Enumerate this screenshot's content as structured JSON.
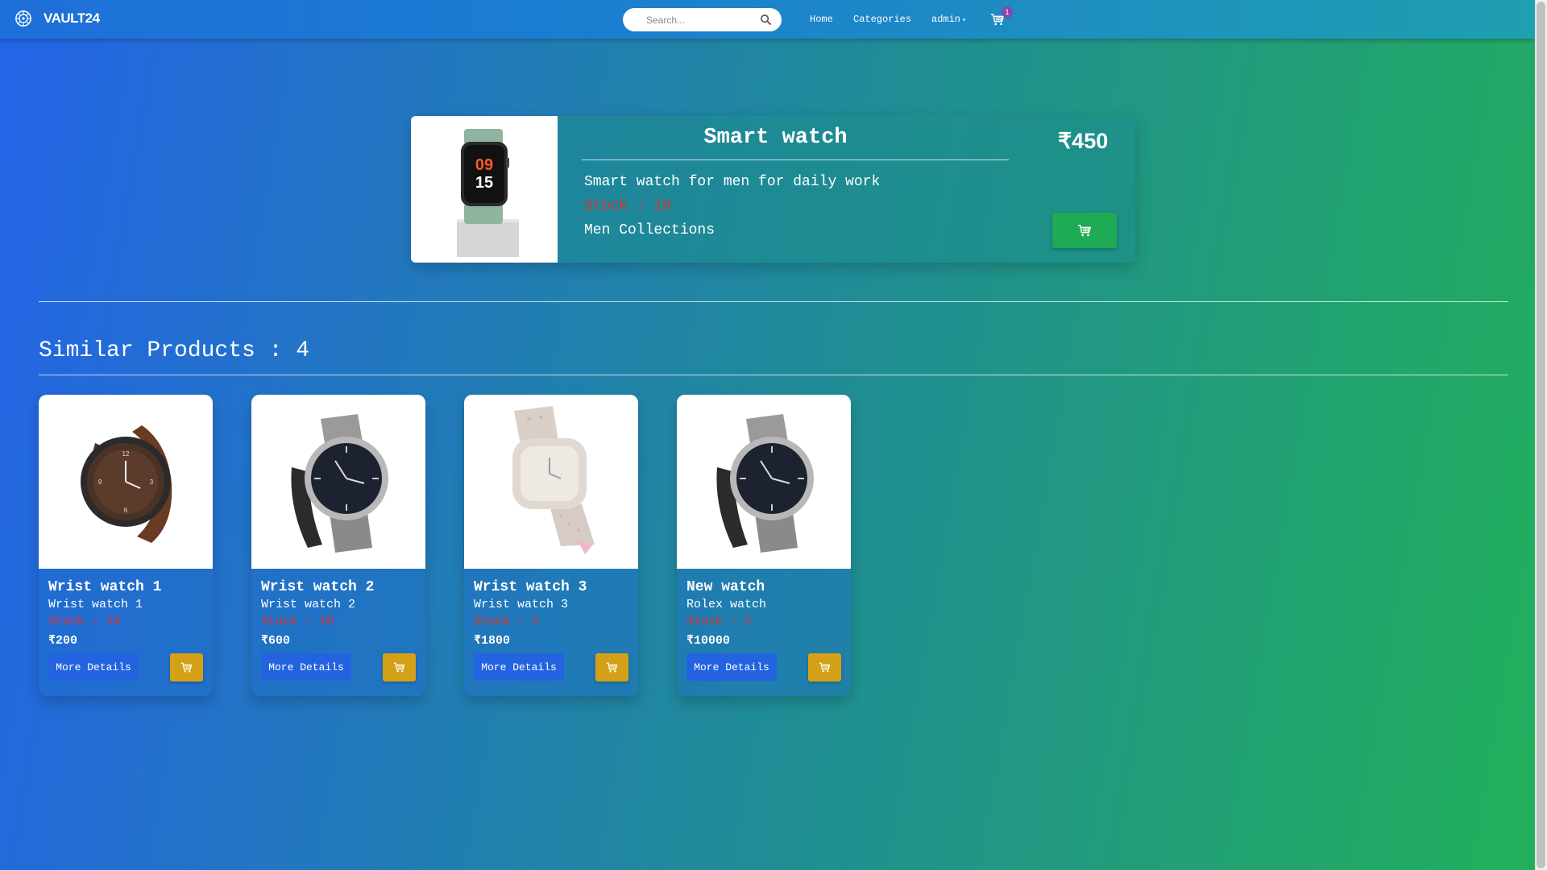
{
  "navbar": {
    "brand": "VAULT24",
    "search_placeholder": "Search...",
    "links": {
      "home": "Home",
      "categories": "Categories",
      "admin": "admin"
    },
    "cart_count": "1"
  },
  "product": {
    "title": "Smart watch",
    "price": "₹450",
    "description": "Smart watch for men for daily work",
    "stock": "Stock : 10",
    "category": "Men Collections"
  },
  "similar": {
    "heading": "Similar Products : 4",
    "items": [
      {
        "title": "Wrist watch 1",
        "description": "Wrist watch 1",
        "stock": "Stock : 10",
        "price": "₹200",
        "button": "More Details"
      },
      {
        "title": "Wrist watch 2",
        "description": "Wrist watch 2",
        "stock": "Stock : 10",
        "price": "₹600",
        "button": "More Details"
      },
      {
        "title": "Wrist watch 3",
        "description": "Wrist watch 3",
        "stock": "Stock : 1",
        "price": "₹1800",
        "button": "More Details"
      },
      {
        "title": "New watch",
        "description": "Rolex watch",
        "stock": "Stock : 1",
        "price": "₹10000",
        "button": "More Details"
      }
    ]
  },
  "colors": {
    "stock_red": "#e03030",
    "add_to_cart_green": "#1faa55",
    "add_to_cart_gold": "#d4a017",
    "details_blue": "#2463e0",
    "badge_purple": "#8e44ad"
  }
}
